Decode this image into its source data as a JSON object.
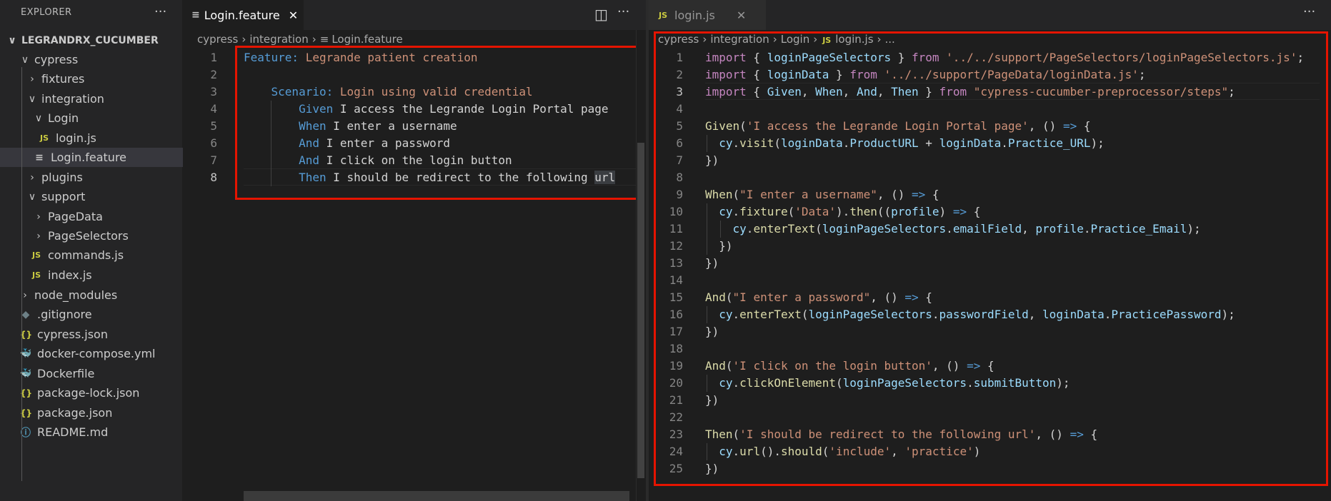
{
  "explorer": {
    "title": "EXPLORER",
    "more": "···",
    "items": [
      {
        "label": "LEGRANDRX_CUCUMBER",
        "chev": "∨",
        "icon": "",
        "bold": true
      },
      {
        "label": "cypress",
        "chev": "∨",
        "icon": ""
      },
      {
        "label": "fixtures",
        "chev": "›",
        "icon": ""
      },
      {
        "label": "integration",
        "chev": "∨",
        "icon": ""
      },
      {
        "label": "Login",
        "chev": "∨",
        "icon": ""
      },
      {
        "label": "login.js",
        "chev": "",
        "icon": "JS"
      },
      {
        "label": "Login.feature",
        "chev": "",
        "icon": "≡",
        "selected": true
      },
      {
        "label": "plugins",
        "chev": "›",
        "icon": ""
      },
      {
        "label": "support",
        "chev": "∨",
        "icon": ""
      },
      {
        "label": "PageData",
        "chev": "›",
        "icon": ""
      },
      {
        "label": "PageSelectors",
        "chev": "›",
        "icon": ""
      },
      {
        "label": "commands.js",
        "chev": "",
        "icon": "JS"
      },
      {
        "label": "index.js",
        "chev": "",
        "icon": "JS"
      },
      {
        "label": "node_modules",
        "chev": "›",
        "icon": ""
      },
      {
        "label": ".gitignore",
        "chev": "",
        "icon": "◆"
      },
      {
        "label": "cypress.json",
        "chev": "",
        "icon": "{}"
      },
      {
        "label": "docker-compose.yml",
        "chev": "",
        "icon": "🐳"
      },
      {
        "label": "Dockerfile",
        "chev": "",
        "icon": "🐳"
      },
      {
        "label": "package-lock.json",
        "chev": "",
        "icon": "{}"
      },
      {
        "label": "package.json",
        "chev": "",
        "icon": "{}"
      },
      {
        "label": "README.md",
        "chev": "",
        "icon": "ⓘ"
      }
    ]
  },
  "group1": {
    "tab_label": "Login.feature",
    "tab_close": "✕",
    "split_icon": "◫",
    "more": "···",
    "breadcrumbs": [
      "cypress",
      "integration",
      "Login.feature"
    ],
    "breadcrumb_sep": "›",
    "line_numbers": [
      "1",
      "2",
      "3",
      "4",
      "5",
      "6",
      "7",
      "8"
    ],
    "lines": {
      "l1_kw": "Feature:",
      "l1_rest": " Legrande patient creation",
      "l3_kw": "Scenario:",
      "l3_rest": " Login using valid credential",
      "l4_kw": "Given",
      "l4_rest": " I access the Legrande Login Portal page",
      "l5_kw": "When",
      "l5_rest": " I enter a username",
      "l6_kw": "And",
      "l6_rest": " I enter a password",
      "l7_kw": "And",
      "l7_rest": " I click on the login button",
      "l8_kw": "Then",
      "l8_rest": " I should be redirect to the following ",
      "l8_sel": "url"
    }
  },
  "group2": {
    "tab_label": "login.js",
    "tab_icon": "JS",
    "tab_close": "✕",
    "more": "···",
    "breadcrumbs": [
      "cypress",
      "integration",
      "Login",
      "login.js",
      "..."
    ],
    "breadcrumb_sep": "›",
    "line_numbers": [
      "1",
      "2",
      "3",
      "4",
      "5",
      "6",
      "7",
      "8",
      "9",
      "10",
      "11",
      "12",
      "13",
      "14",
      "15",
      "16",
      "17",
      "18",
      "19",
      "20",
      "21",
      "22",
      "23",
      "24",
      "25"
    ],
    "code": {
      "import": "import",
      "from": "from",
      "l1_ids": "loginPageSelectors",
      "l1_path": "'../../support/PageSelectors/loginPageSelectors.js'",
      "l2_ids": "loginData",
      "l2_path": "'../../support/PageData/loginData.js'",
      "l3_given": "Given",
      "l3_when": "When",
      "l3_and": "And",
      "l3_then": "Then",
      "l3_path": "\"cypress-cucumber-preprocessor/steps\"",
      "l5_fn": "Given",
      "l5_str": "'I access the Legrande Login Portal page'",
      "l6_cy": "cy",
      "l6_fn": "visit",
      "l6_a": "loginData",
      "l6_p1": "ProductURL",
      "l6_p2": "Practice_URL",
      "l9_fn": "When",
      "l9_str": "\"I enter a username\"",
      "l10_fn1": "fixture",
      "l10_str": "'Data'",
      "l10_fn2": "then",
      "l10_param": "profile",
      "l11_fn": "enterText",
      "l11_a": "loginPageSelectors",
      "l11_p": "emailField",
      "l11_b": "profile",
      "l11_q": "Practice_Email",
      "l15_fn": "And",
      "l15_str": "\"I enter a password\"",
      "l16_fn": "enterText",
      "l16_p": "passwordField",
      "l16_q": "PracticePassword",
      "l19_fn": "And",
      "l19_str": "'I click on the login button'",
      "l20_fn": "clickOnElement",
      "l20_p": "submitButton",
      "l23_fn": "Then",
      "l23_str": "'I should be redirect to the following url'",
      "l24_fn1": "url",
      "l24_fn2": "should",
      "l24_s1": "'include'",
      "l24_s2": "'practice'"
    }
  },
  "colors": {
    "highlight_box": "#e51400",
    "keyword": "#569cd6",
    "string": "#ce9178",
    "function": "#dcdcaa",
    "variable": "#9cdcfe",
    "control": "#c586c0"
  }
}
